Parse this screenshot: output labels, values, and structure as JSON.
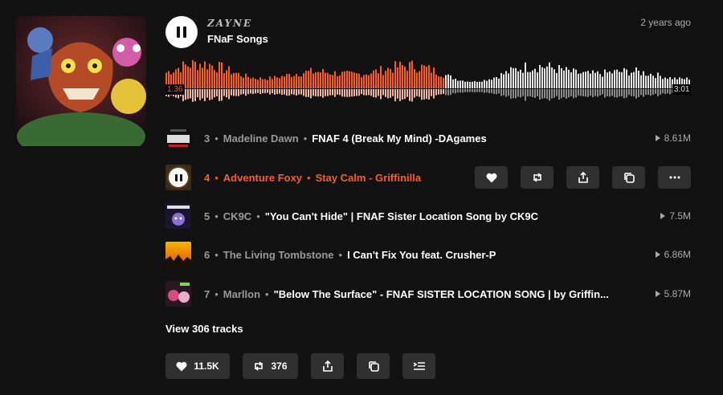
{
  "header": {
    "artist": "ZAYNE",
    "playlist_title": "FNaF Songs",
    "posted": "2 years ago"
  },
  "player": {
    "current_time": "1:36",
    "duration": "3:01",
    "progress": 0.53
  },
  "tracks": [
    {
      "number": "3",
      "artist": "Madeline Dawn",
      "title": "FNAF 4 (Break My Mind) -DAgames",
      "plays": "8.61M",
      "active": false
    },
    {
      "number": "4",
      "artist": "Adventure Foxy",
      "title": "Stay Calm - Griffinilla",
      "plays": "",
      "active": true
    },
    {
      "number": "5",
      "artist": "CK9C",
      "title": "\"You Can't Hide\" | FNAF Sister Location Song by CK9C",
      "plays": "7.5M",
      "active": false
    },
    {
      "number": "6",
      "artist": "The Living Tombstone",
      "title": "I Can't Fix You feat. Crusher-P",
      "plays": "6.86M",
      "active": false
    },
    {
      "number": "7",
      "artist": "Marllon",
      "title": "\"Below The Surface\" - FNAF SISTER LOCATION SONG | by Griffin...",
      "plays": "5.87M",
      "active": false
    }
  ],
  "view_tracks_label": "View 306 tracks",
  "actions": {
    "likes": "11.5K",
    "reposts": "376"
  },
  "colors": {
    "accent": "#ff5a1f",
    "background": "#121212",
    "button": "#303030"
  },
  "icons": [
    "pause-icon",
    "heart-icon",
    "repost-icon",
    "share-icon",
    "copy-icon",
    "more-icon",
    "add-to-next-up-icon"
  ]
}
